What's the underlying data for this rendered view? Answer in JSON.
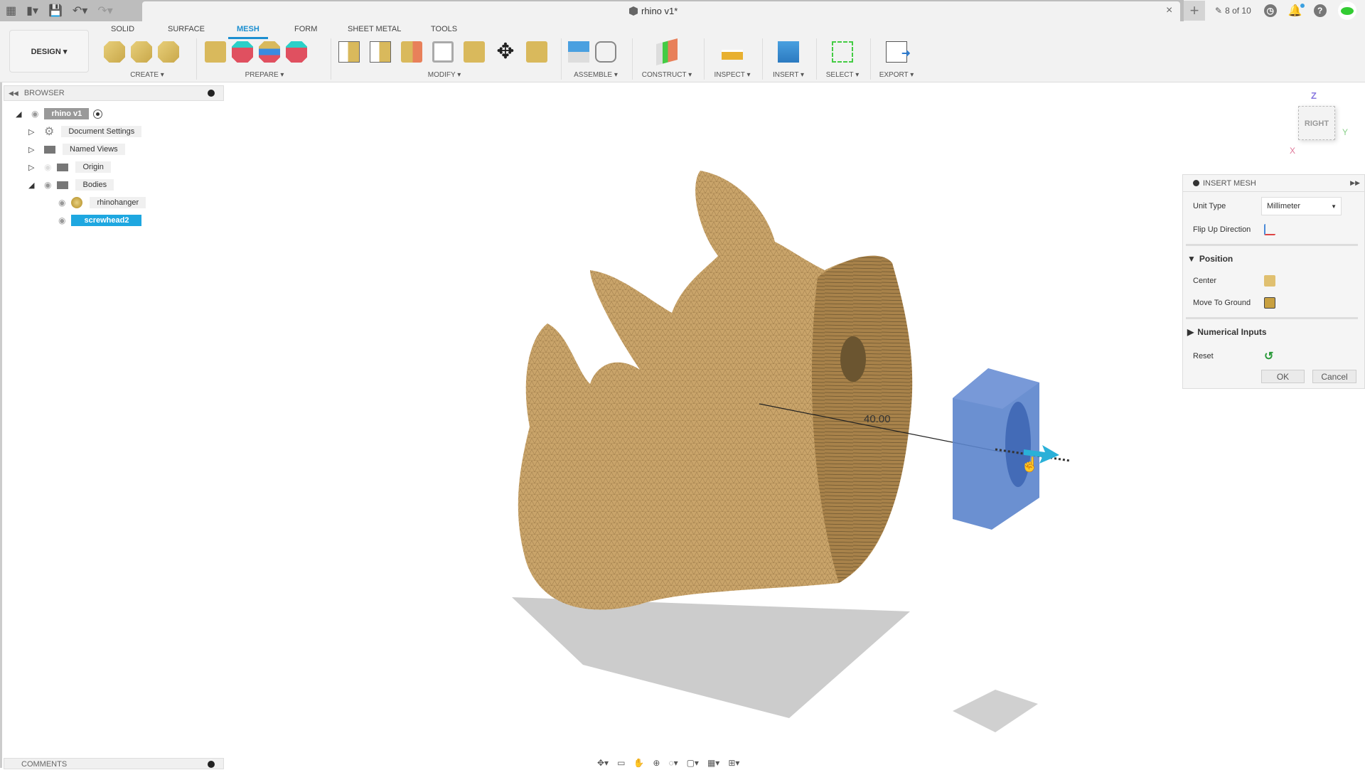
{
  "titlebar": {
    "document_title": "rhino v1*",
    "job_status": "8 of 10",
    "new_tab": "+",
    "close": "×",
    "icons": [
      "apps-grid-icon",
      "file-icon",
      "save-icon",
      "undo-icon",
      "redo-icon"
    ]
  },
  "ribbon": {
    "workspace": "DESIGN ▾",
    "tabs": [
      {
        "label": "SOLID",
        "active": false
      },
      {
        "label": "SURFACE",
        "active": false
      },
      {
        "label": "MESH",
        "active": true
      },
      {
        "label": "FORM",
        "active": false
      },
      {
        "label": "SHEET METAL",
        "active": false
      },
      {
        "label": "TOOLS",
        "active": false
      }
    ],
    "groups": [
      {
        "label": "CREATE ▾"
      },
      {
        "label": "PREPARE ▾"
      },
      {
        "label": "MODIFY ▾"
      },
      {
        "label": "ASSEMBLE ▾"
      },
      {
        "label": "CONSTRUCT ▾"
      },
      {
        "label": "INSPECT ▾"
      },
      {
        "label": "INSERT ▾"
      },
      {
        "label": "SELECT ▾"
      },
      {
        "label": "EXPORT ▾"
      }
    ],
    "accent_color": "#1c8fd0"
  },
  "browser": {
    "title": "BROWSER",
    "root": "rhino v1",
    "items": [
      {
        "label": "Document Settings"
      },
      {
        "label": "Named Views"
      },
      {
        "label": "Origin"
      },
      {
        "label": "Bodies"
      },
      {
        "label": "rhinohanger"
      },
      {
        "label": "screwhead2",
        "selected": true
      }
    ]
  },
  "comments": {
    "title": "COMMENTS"
  },
  "viewport": {
    "dimension_label": "40.00",
    "viewcube": {
      "face": "RIGHT",
      "z": "Z",
      "x": "X",
      "y": "Y"
    }
  },
  "insert_mesh": {
    "title": "INSERT MESH",
    "unit_type_label": "Unit Type",
    "unit_type_value": "Millimeter",
    "flip_label": "Flip Up Direction",
    "position_label": "Position",
    "center_label": "Center",
    "ground_label": "Move To Ground",
    "numerical_label": "Numerical Inputs",
    "reset_label": "Reset",
    "ok": "OK",
    "cancel": "Cancel"
  }
}
